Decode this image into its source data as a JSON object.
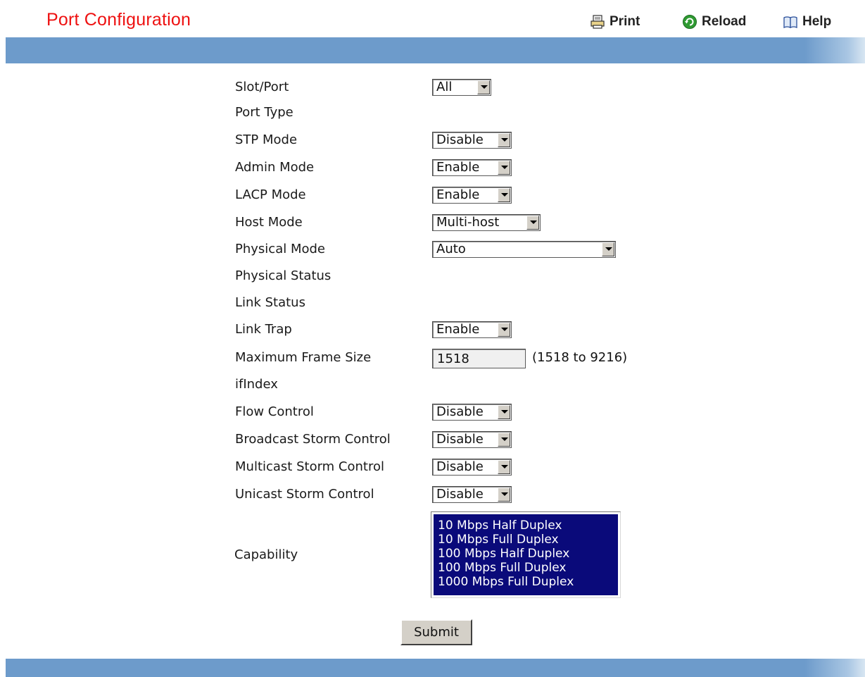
{
  "header": {
    "title": "Port Configuration",
    "print_label": "Print",
    "reload_label": "Reload",
    "help_label": "Help"
  },
  "form": {
    "slot_port": {
      "label": "Slot/Port",
      "value": "All"
    },
    "port_type": {
      "label": "Port Type"
    },
    "stp_mode": {
      "label": "STP Mode",
      "value": "Disable"
    },
    "admin_mode": {
      "label": "Admin Mode",
      "value": "Enable"
    },
    "lacp_mode": {
      "label": "LACP Mode",
      "value": "Enable"
    },
    "host_mode": {
      "label": "Host Mode",
      "value": "Multi-host"
    },
    "physical_mode": {
      "label": "Physical Mode",
      "value": "Auto"
    },
    "physical_status": {
      "label": "Physical Status"
    },
    "link_status": {
      "label": "Link Status"
    },
    "link_trap": {
      "label": "Link Trap",
      "value": "Enable"
    },
    "max_frame_size": {
      "label": "Maximum Frame Size",
      "value": "1518",
      "range": "(1518 to 9216)"
    },
    "if_index": {
      "label": "ifIndex"
    },
    "flow_control": {
      "label": "Flow Control",
      "value": "Disable"
    },
    "broadcast_storm": {
      "label": "Broadcast Storm Control",
      "value": "Disable"
    },
    "multicast_storm": {
      "label": "Multicast Storm Control",
      "value": "Disable"
    },
    "unicast_storm": {
      "label": "Unicast Storm Control",
      "value": "Disable"
    },
    "capability": {
      "label": "Capability",
      "options": [
        "10 Mbps Half Duplex",
        "10 Mbps Full Duplex",
        "100 Mbps Half Duplex",
        "100 Mbps Full Duplex",
        "1000 Mbps Full Duplex"
      ]
    },
    "submit_label": "Submit"
  },
  "colors": {
    "title": "#ee1111",
    "bar": "#6d9bcb",
    "listbox_selected": "#0a0a7a"
  },
  "icons": {
    "print": "printer-icon",
    "reload": "reload-icon",
    "help": "help-book-icon"
  }
}
